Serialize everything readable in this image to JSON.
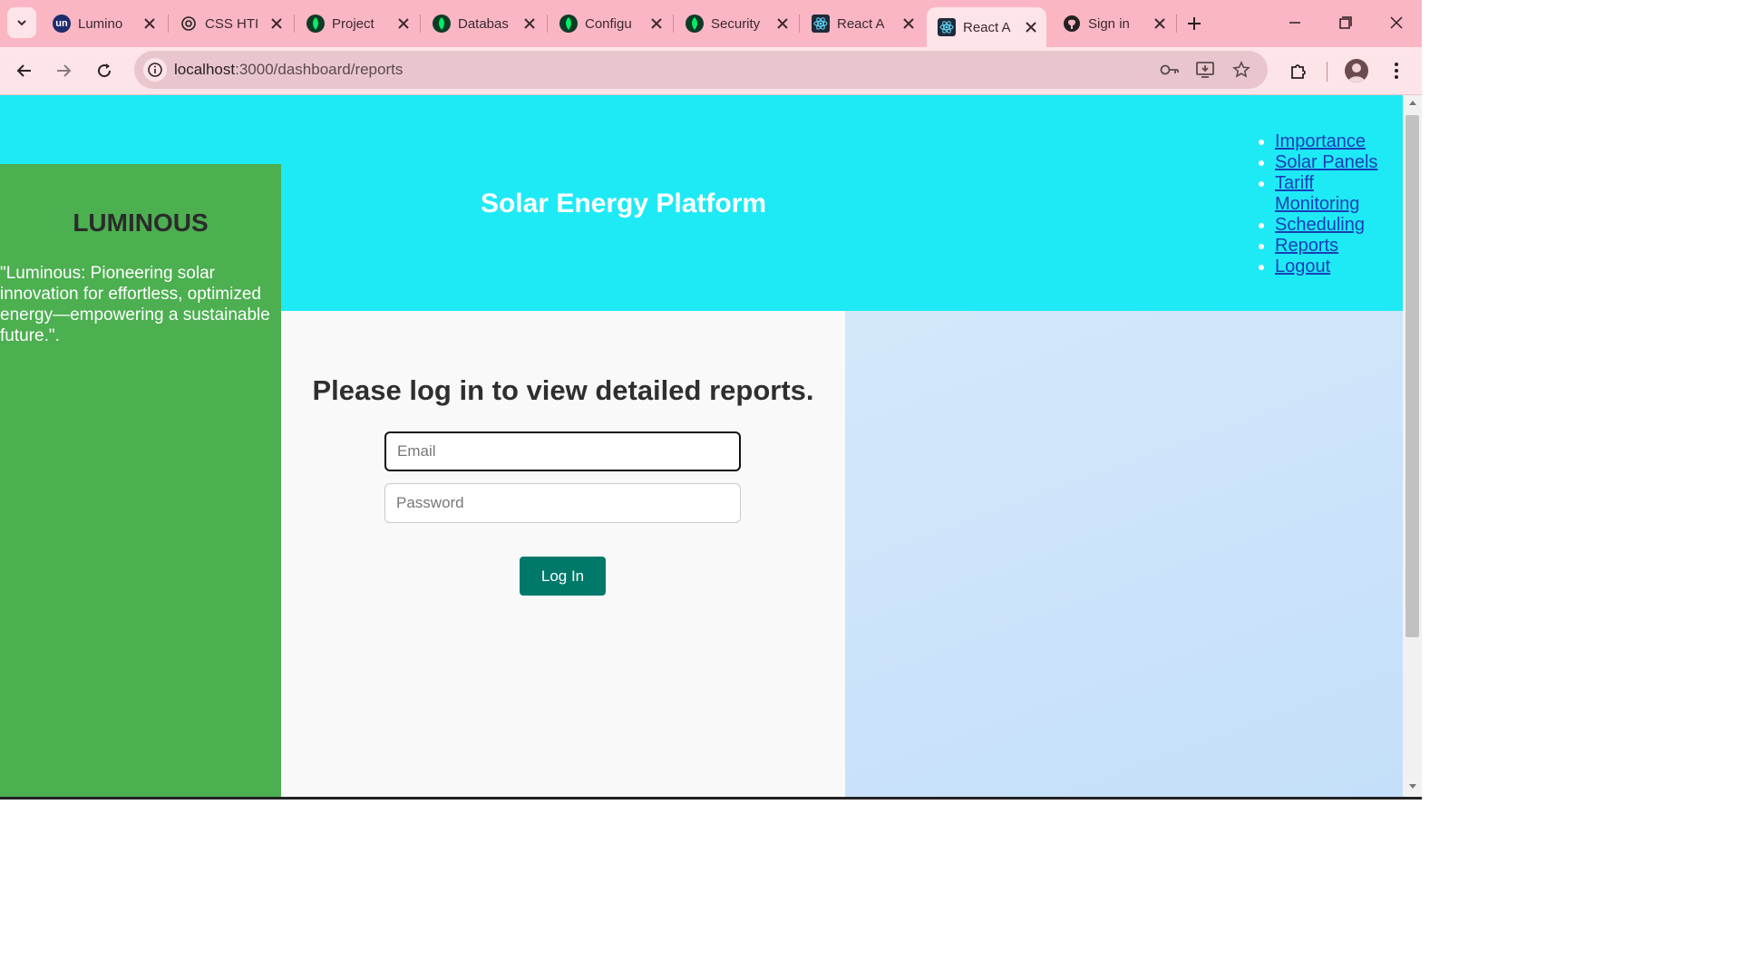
{
  "browser": {
    "tabs": [
      {
        "title": "Lumino",
        "favicon": "un-icon"
      },
      {
        "title": "CSS HTI",
        "favicon": "openai-icon"
      },
      {
        "title": "Project",
        "favicon": "mongodb-leaf-icon"
      },
      {
        "title": "Databas",
        "favicon": "mongodb-leaf-icon"
      },
      {
        "title": "Configu",
        "favicon": "mongodb-leaf-icon"
      },
      {
        "title": "Security",
        "favicon": "mongodb-leaf-icon"
      },
      {
        "title": "React A",
        "favicon": "react-icon"
      },
      {
        "title": "React A",
        "favicon": "react-icon",
        "active": true
      },
      {
        "title": "Sign in",
        "favicon": "github-icon"
      }
    ],
    "favicon_un_text": "un",
    "url_host": "localhost",
    "url_rest": ":3000/dashboard/reports",
    "colors": {
      "tabbar": "#fbb6c3",
      "toolbar": "#fde4e9"
    }
  },
  "header": {
    "title": "Solar Energy Platform",
    "nav": [
      "Importance",
      "Solar Panels",
      "Tariff Monitoring",
      "Scheduling",
      "Reports",
      "Logout"
    ],
    "colors": {
      "background": "#1eeaf6",
      "link": "#1a3fb8"
    }
  },
  "sidebar": {
    "brand": "LUMINOUS",
    "tagline": "\"Luminous: Pioneering solar innovation for effortless, optimized energy—empowering a sustainable future.\".",
    "colors": {
      "background": "#4caf50"
    }
  },
  "login": {
    "heading": "Please log in to view detailed reports.",
    "email_placeholder": "Email",
    "password_placeholder": "Password",
    "button_label": "Log In",
    "colors": {
      "button": "#00796b"
    }
  }
}
